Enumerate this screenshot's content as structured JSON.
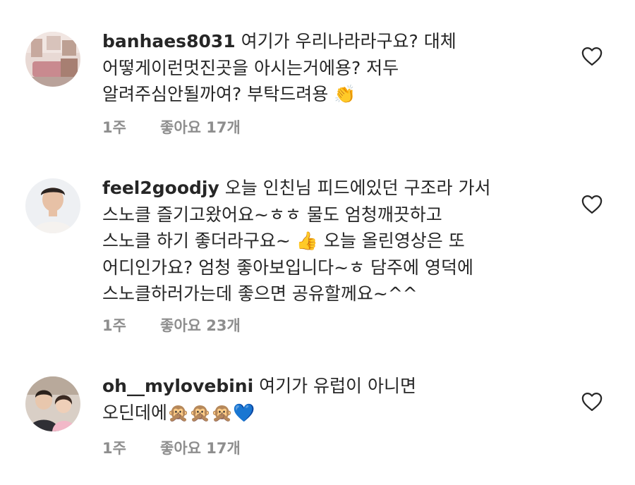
{
  "comments": [
    {
      "username": "banhaes8031",
      "text": "여기가 우리나라라구요? 대체\n어떻게이런멋진곳을 아시는거에용? 저두\n알려주심안될까여? 부탁드려용 👏",
      "time": "1주",
      "likes": "좋아요 17개",
      "avatar": "avatar-interior-room"
    },
    {
      "username": "feel2goodjy",
      "text": "오늘 인친님 피드에있던 구조라 가서\n스노클 즐기고왔어요~ㅎㅎ  물도 엄청깨끗하고\n스노클 하기 좋더라구요~ 👍  오늘 올린영상은 또\n어디인가요? 엄청 좋아보입니다~ㅎ  담주에 영덕에\n스노클하러가는데 좋으면 공유할께요~^^",
      "time": "1주",
      "likes": "좋아요 23개",
      "avatar": "avatar-man"
    },
    {
      "username": "oh__mylovebini",
      "text": "여기가 유럽이 아니면\n오딘데에🙊🙊🙊💙",
      "time": "1주",
      "likes": "좋아요 17개",
      "avatar": "avatar-two-kids"
    }
  ],
  "icons": {
    "like": "heart-outline-icon"
  },
  "colors": {
    "text": "#262626",
    "meta": "#8e8e8e",
    "heart": "#262626"
  }
}
